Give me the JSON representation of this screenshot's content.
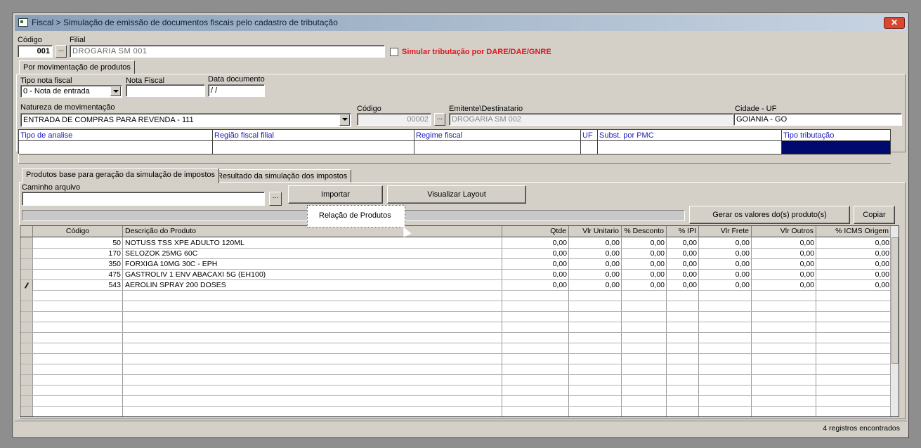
{
  "window": {
    "title": "Fiscal > Simulação de emissão de documentos fiscais pelo cadastro de tributação",
    "close_glyph": "✕"
  },
  "header": {
    "codigo_label": "Código",
    "codigo_value": "001",
    "filial_label": "Filial",
    "filial_value": "DROGARIA SM 001",
    "simular_label": "Simular tributação por DARE/DAE/GNRE",
    "browse_glyph": "..."
  },
  "top_tab": {
    "label": "Por movimentação de produtos"
  },
  "movimento": {
    "tipo_nota_label": "Tipo nota fiscal",
    "tipo_nota_value": "0 - Nota de entrada",
    "nota_fiscal_label": "Nota Fiscal",
    "nota_fiscal_value": "",
    "data_documento_label": "Data documento",
    "data_documento_value": " /  /",
    "natureza_label": "Natureza de movimentação",
    "natureza_value": "ENTRADA DE COMPRAS PARA REVENDA - 111",
    "codigo_label": "Código",
    "codigo_value": "00002",
    "emitente_label": "Emitente\\Destinatario",
    "emitente_value": "DROGARIA SM 002",
    "cidade_label": "Cidade - UF",
    "cidade_value": "GOIANIA - GO"
  },
  "analysis": {
    "headers": [
      "Tipo de analise",
      "Região fiscal filial",
      "Regime fiscal",
      "UF",
      "Subst. por PMC",
      "Tipo tributação"
    ]
  },
  "sub_tabs": [
    {
      "label": "Produtos base para geração da simulação de impostos"
    },
    {
      "label": "Resultado da simulação dos impostos"
    }
  ],
  "import": {
    "caminho_label": "Caminho arquivo",
    "caminho_value": "",
    "importar_label": "Importar",
    "visualizar_label": "Visualizar Layout",
    "gerar_label": "Gerar os valores do(s) produto(s)",
    "copiar_label": "Copiar",
    "tooltip": "Relação de Produtos"
  },
  "grid": {
    "headers": [
      "Código",
      "Descrição do Produto",
      "Qtde",
      "Vlr Unitario",
      "% Desconto",
      "% IPI",
      "Vlr Frete",
      "Vlr Outros",
      "% ICMS Origem"
    ],
    "rows": [
      {
        "codigo": "50",
        "descricao": "NOTUSS TSS XPE ADULTO 120ML",
        "qtde": "0,00",
        "vlr_unit": "0,00",
        "desconto": "0,00",
        "ipi": "0,00",
        "frete": "0,00",
        "outros": "0,00",
        "icms": "0,00"
      },
      {
        "codigo": "170",
        "descricao": "SELOZOK 25MG 60C",
        "qtde": "0,00",
        "vlr_unit": "0,00",
        "desconto": "0,00",
        "ipi": "0,00",
        "frete": "0,00",
        "outros": "0,00",
        "icms": "0,00"
      },
      {
        "codigo": "350",
        "descricao": "FORXIGA 10MG 30C - EPH",
        "qtde": "0,00",
        "vlr_unit": "0,00",
        "desconto": "0,00",
        "ipi": "0,00",
        "frete": "0,00",
        "outros": "0,00",
        "icms": "0,00"
      },
      {
        "codigo": "475",
        "descricao": "GASTROLIV 1 ENV ABACAXI 5G (EH100)",
        "qtde": "0,00",
        "vlr_unit": "0,00",
        "desconto": "0,00",
        "ipi": "0,00",
        "frete": "0,00",
        "outros": "0,00",
        "icms": "0,00"
      },
      {
        "codigo": "543",
        "descricao": "AEROLIN SPRAY 200 DOSES",
        "qtde": "0,00",
        "vlr_unit": "0,00",
        "desconto": "0,00",
        "ipi": "0,00",
        "frete": "0,00",
        "outros": "0,00",
        "icms": "0,00"
      }
    ]
  },
  "status": {
    "text": "4 registros encontrados"
  },
  "colors": {
    "title_gradient_start": "#8aa0b8",
    "alert_red": "#e0141e",
    "header_blue": "#1a1ab8",
    "selected_navy": "#000a6e"
  }
}
